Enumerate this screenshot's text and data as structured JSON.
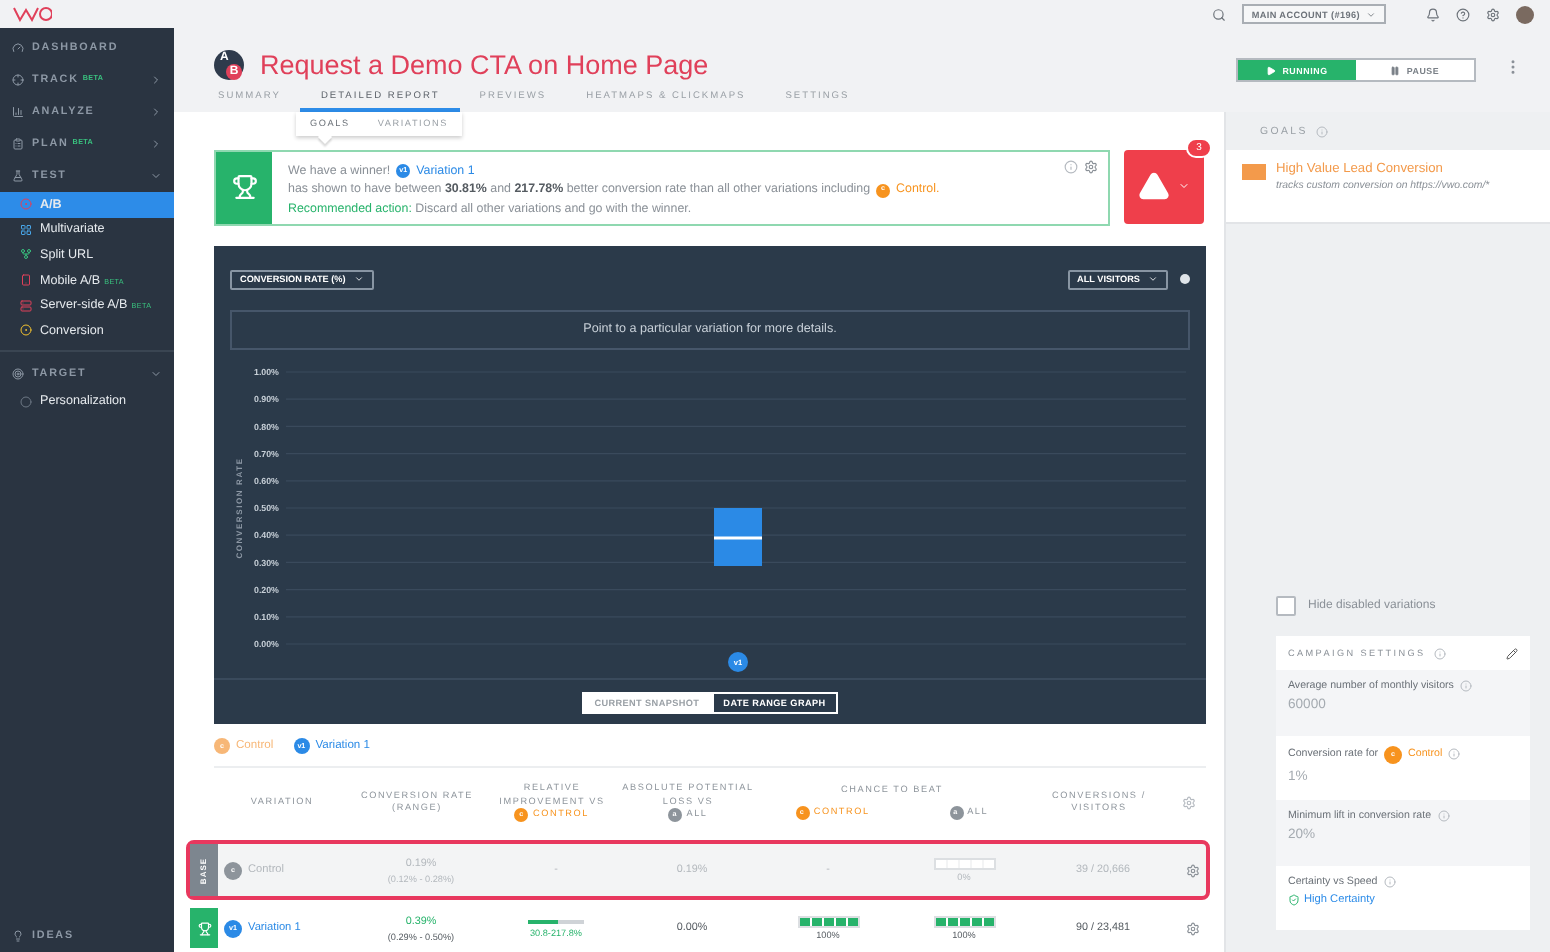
{
  "topbar": {
    "account": "MAIN ACCOUNT (#196)"
  },
  "sidebar": {
    "items": [
      {
        "kind": "link",
        "label": "DASHBOARD"
      },
      {
        "kind": "section",
        "label": "TRACK",
        "beta": "BETA",
        "expanded": false
      },
      {
        "kind": "section",
        "label": "ANALYZE",
        "expanded": false
      },
      {
        "kind": "section",
        "label": "PLAN",
        "beta": "BETA",
        "expanded": false
      },
      {
        "kind": "section",
        "label": "TEST",
        "expanded": true,
        "children": [
          {
            "label": "A/B",
            "selected": true
          },
          {
            "label": "Multivariate",
            "selected": false
          },
          {
            "label": "Split URL",
            "selected": false
          },
          {
            "label": "Mobile A/B",
            "beta": "BETA",
            "selected": false
          },
          {
            "label": "Server-side A/B",
            "beta": "BETA",
            "selected": false
          },
          {
            "label": "Conversion",
            "selected": false
          }
        ]
      },
      {
        "kind": "section",
        "label": "TARGET",
        "expanded": true,
        "children": [
          {
            "label": "Personalization",
            "selected": false
          }
        ]
      }
    ],
    "footer": "IDEAS"
  },
  "campaign": {
    "icon_letters": [
      "A",
      "B"
    ],
    "title": "Request a Demo CTA on Home Page",
    "tabs": [
      {
        "label": "SUMMARY",
        "selected": false
      },
      {
        "label": "DETAILED REPORT",
        "selected": true
      },
      {
        "label": "PREVIEWS",
        "selected": false
      },
      {
        "label": "HEATMAPS & CLICKMAPS",
        "selected": false
      },
      {
        "label": "SETTINGS",
        "selected": false
      }
    ],
    "status": [
      {
        "label": "RUNNING",
        "selected": true
      },
      {
        "label": "PAUSE",
        "selected": false
      }
    ]
  },
  "subtabs": [
    {
      "label": "GOALS",
      "selected": true
    },
    {
      "label": "VARIATIONS",
      "selected": false
    }
  ],
  "winner": {
    "segments": [
      {
        "kind": "text",
        "text": "We have a winner!"
      },
      {
        "kind": "badge",
        "text": "v1",
        "color": "#2b8ae6"
      },
      {
        "kind": "link",
        "text": "Variation 1",
        "color": "#2b8ae6"
      },
      {
        "kind": "text",
        "text": "has shown to have between **30.81%** and **217.78%** better conversion rate than all other variations including"
      },
      {
        "kind": "badge",
        "text": "c",
        "color": "#f7931e"
      },
      {
        "kind": "link",
        "text": "Control.",
        "color": "#f7931e"
      }
    ],
    "action_label": "Recommended action:",
    "action_text": "Discard all other variations and go with the winner."
  },
  "alert": {
    "count": "3"
  },
  "chart": {
    "metric": "CONVERSION RATE (%)",
    "segment": "ALL VISITORS",
    "hint": "Point to a particular variation for more details.",
    "plot": {
      "ylabel": "CONVERSION RATE",
      "category": "v1",
      "ticks": [
        "1.00%",
        "0.90%",
        "0.80%",
        "0.70%",
        "0.60%",
        "0.50%",
        "0.40%",
        "0.30%",
        "0.20%",
        "0.10%",
        "0.00%"
      ]
    },
    "views": [
      {
        "label": "CURRENT SNAPSHOT",
        "selected": true
      },
      {
        "label": "DATE RANGE GRAPH",
        "selected": false
      }
    ]
  },
  "legend": [
    {
      "badge": "c",
      "label": "Control",
      "color": "#f7b777"
    },
    {
      "badge": "v1",
      "label": "Variation 1",
      "color": "#2b8ae6"
    }
  ],
  "table": {
    "columns": [
      {
        "kind": "plain",
        "label": "VARIATION"
      },
      {
        "kind": "plain",
        "label": "CONVERSION RATE (RANGE)"
      },
      {
        "kind": "versus",
        "label": "RELATIVE IMPROVEMENT VS",
        "badge": "c",
        "target": "CONTROL",
        "color": "#f7931e"
      },
      {
        "kind": "versus",
        "label": "ABSOLUTE POTENTIAL LOSS VS",
        "badge": "a",
        "target": "ALL",
        "color": "#8d949b"
      },
      {
        "kind": "group",
        "label": "CHANCE TO BEAT",
        "subs": [
          {
            "badge": "c",
            "target": "CONTROL",
            "color": "#f7931e"
          },
          {
            "badge": "a",
            "target": "ALL",
            "color": "#8d949b"
          }
        ]
      },
      {
        "kind": "plain",
        "label": "CONVERSIONS / VISITORS"
      }
    ],
    "rows": [
      {
        "kind": "base",
        "tag": "BASE",
        "badge": "c",
        "name": "Control",
        "selected": true,
        "rate": "0.19%",
        "range": "(0.12% - 0.28%)",
        "improvement": {
          "text": "-"
        },
        "loss": "0.19%",
        "beat_control": {
          "text": "-"
        },
        "beat_all": {
          "label": "0%"
        },
        "conversions": "39 / 20,666"
      },
      {
        "kind": "winner",
        "badge": "v1",
        "name": "Variation 1",
        "selected": false,
        "rate": "0.39%",
        "range": "(0.29% - 0.50%)",
        "improvement": {
          "level": 0.55,
          "label": "30.8-217.8%"
        },
        "loss": "0.00%",
        "beat_control": {
          "level": 1,
          "label": "100%"
        },
        "beat_all": {
          "level": 1,
          "label": "100%"
        },
        "conversions": "90 / 23,481"
      }
    ]
  },
  "goals": {
    "title": "GOALS",
    "items": [
      {
        "name": "High Value Lead Conversion",
        "description": "tracks custom conversion on https://vwo.com/*"
      }
    ]
  },
  "hide_disabled": {
    "label": "Hide disabled variations",
    "checked": false
  },
  "settings": {
    "title": "CAMPAIGN SETTINGS",
    "fields": [
      {
        "kind": "input",
        "label": "Average number of monthly visitors",
        "value": "60000"
      },
      {
        "kind": "input",
        "label": "Conversion rate for",
        "badge": "c",
        "link": "Control",
        "value": "1%"
      },
      {
        "kind": "input",
        "label": "Minimum lift in conversion rate",
        "value": "20%"
      },
      {
        "kind": "choice",
        "label": "Certainty vs Speed",
        "value": "High Certainty"
      }
    ]
  }
}
